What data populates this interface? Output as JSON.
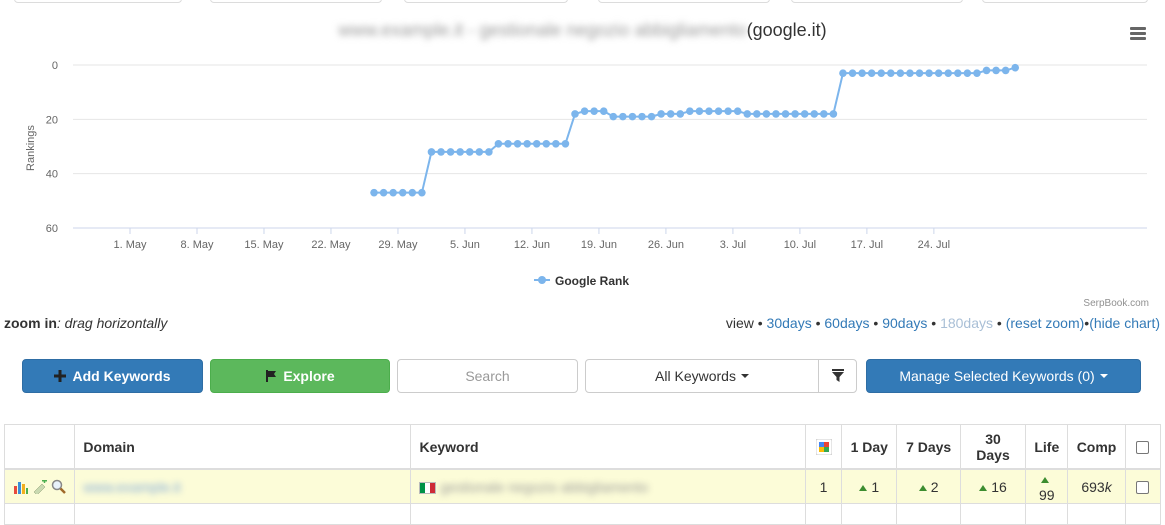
{
  "chart": {
    "title_blurred": "www.example.it - gestionale negozio abbigliamento",
    "title_suffix": "(google.it)",
    "menu_icon": "hamburger-menu-icon",
    "credit": "SerpBook.com",
    "colors": {
      "series": "#7cb5ec",
      "grid": "#e6e6e6"
    }
  },
  "chart_data": {
    "type": "line",
    "title": "(google.it)",
    "ylabel": "Rankings",
    "xlabel": "",
    "y_reversed": true,
    "ylim": [
      0,
      60
    ],
    "y_ticks": [
      0,
      20,
      40,
      60
    ],
    "x_tick_labels": [
      "1. May",
      "8. May",
      "15. May",
      "22. May",
      "29. May",
      "5. Jun",
      "12. Jun",
      "19. Jun",
      "26. Jun",
      "3. Jul",
      "10. Jul",
      "17. Jul",
      "24. Jul"
    ],
    "x_start_label": "1. May",
    "legend": {
      "position": "bottom-center"
    },
    "series": [
      {
        "name": "Google Rank",
        "points": [
          [
            26.5,
            47
          ],
          [
            27.5,
            47
          ],
          [
            28.5,
            47
          ],
          [
            29.5,
            47
          ],
          [
            30.5,
            47
          ],
          [
            31.5,
            47
          ],
          [
            32.5,
            32
          ],
          [
            33.5,
            32
          ],
          [
            34.5,
            32
          ],
          [
            35.5,
            32
          ],
          [
            36.5,
            32
          ],
          [
            37.5,
            32
          ],
          [
            38.5,
            32
          ],
          [
            39.5,
            29
          ],
          [
            40.5,
            29
          ],
          [
            41.5,
            29
          ],
          [
            42.5,
            29
          ],
          [
            43.5,
            29
          ],
          [
            44.5,
            29
          ],
          [
            45.5,
            29
          ],
          [
            46.5,
            29
          ],
          [
            47.5,
            18
          ],
          [
            48.5,
            17
          ],
          [
            49.5,
            17
          ],
          [
            50.5,
            17
          ],
          [
            51.5,
            19
          ],
          [
            52.5,
            19
          ],
          [
            53.5,
            19
          ],
          [
            54.5,
            19
          ],
          [
            55.5,
            19
          ],
          [
            56.5,
            18
          ],
          [
            57.5,
            18
          ],
          [
            58.5,
            18
          ],
          [
            59.5,
            17
          ],
          [
            60.5,
            17
          ],
          [
            61.5,
            17
          ],
          [
            62.5,
            17
          ],
          [
            63.5,
            17
          ],
          [
            64.5,
            17
          ],
          [
            65.5,
            18
          ],
          [
            66.5,
            18
          ],
          [
            67.5,
            18
          ],
          [
            68.5,
            18
          ],
          [
            69.5,
            18
          ],
          [
            70.5,
            18
          ],
          [
            71.5,
            18
          ],
          [
            72.5,
            18
          ],
          [
            73.5,
            18
          ],
          [
            74.5,
            18
          ],
          [
            75.5,
            3
          ],
          [
            76.5,
            3
          ],
          [
            77.5,
            3
          ],
          [
            78.5,
            3
          ],
          [
            79.5,
            3
          ],
          [
            80.5,
            3
          ],
          [
            81.5,
            3
          ],
          [
            82.5,
            3
          ],
          [
            83.5,
            3
          ],
          [
            84.5,
            3
          ],
          [
            85.5,
            3
          ],
          [
            86.5,
            3
          ],
          [
            87.5,
            3
          ],
          [
            88.5,
            3
          ],
          [
            89.5,
            3
          ],
          [
            90.5,
            2
          ],
          [
            91.5,
            2
          ],
          [
            92.5,
            2
          ],
          [
            93.5,
            1
          ]
        ]
      }
    ]
  },
  "zoom": {
    "label": "zoom in",
    "hint": ": drag horizontally"
  },
  "view": {
    "prefix": "view •",
    "d30": "30days",
    "d60": "60days",
    "d90": "90days",
    "d180": "180days",
    "reset": "(reset zoom)",
    "hide": "(hide chart)",
    "sep": " • "
  },
  "toolbar": {
    "add_label": "Add Keywords",
    "explore_label": "Explore",
    "search_placeholder": "Search",
    "filter_label": "All Keywords",
    "manage_label": "Manage Selected Keywords (0)"
  },
  "table": {
    "headers": {
      "domain": "Domain",
      "keyword": "Keyword",
      "day1": "1 Day",
      "day7": "7 Days",
      "day30": "30 Days",
      "life": "Life",
      "comp": "Comp"
    },
    "rows": [
      {
        "domain_blurred": "www.example.it",
        "keyword_blurred": "gestionale negozio abbigliamento",
        "google_rank": "1",
        "day1": "1",
        "day7": "2",
        "day30": "16",
        "life": "99",
        "comp_num": "693",
        "comp_unit": "k"
      }
    ]
  }
}
